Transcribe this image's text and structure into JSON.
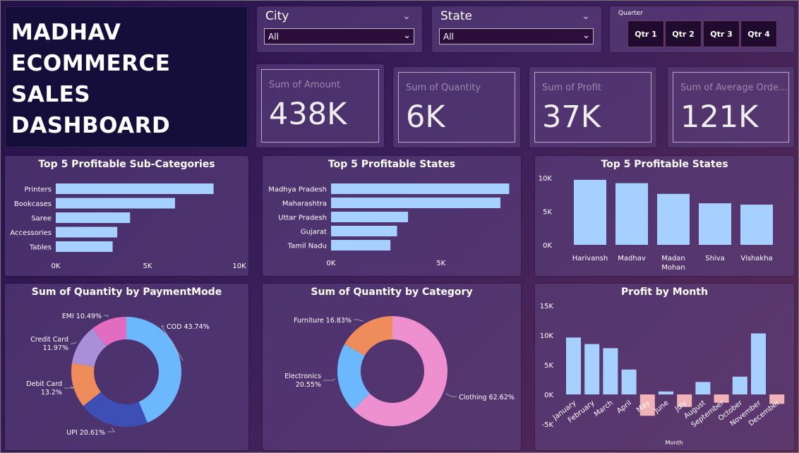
{
  "header": {
    "title_line1": "MADHAV",
    "title_line2": "ECOMMERCE",
    "title_line3": "SALES DASHBOARD"
  },
  "slicers": {
    "city": {
      "label": "City",
      "value": "All"
    },
    "state": {
      "label": "State",
      "value": "All"
    },
    "quarter": {
      "label": "Quarter",
      "options": [
        "Qtr 1",
        "Qtr 2",
        "Qtr 3",
        "Qtr 4"
      ]
    }
  },
  "kpis": [
    {
      "label": "Sum of Amount",
      "value": "438K"
    },
    {
      "label": "Sum of Quantity",
      "value": "6K"
    },
    {
      "label": "Sum of Profit",
      "value": "37K"
    },
    {
      "label": "Sum of Average Orde...",
      "value": "121K"
    }
  ],
  "colors": {
    "bar": "#a6d0ff",
    "negative": "#f2b3b8",
    "cod": "#6cb8ff",
    "upi": "#3d4fb5",
    "debit": "#ee8c5b",
    "credit": "#a98fd8",
    "emi": "#e26cbf",
    "clothing": "#ee8fd0",
    "electronics": "#6cb8ff",
    "furniture": "#ee8c5b"
  },
  "chart_data": [
    {
      "type": "bar",
      "orientation": "horizontal",
      "title": "Top 5 Profitable Sub-Categories",
      "categories": [
        "Printers",
        "Bookcases",
        "Saree",
        "Accessories",
        "Tables"
      ],
      "values": [
        8600,
        6500,
        4050,
        3350,
        3100
      ],
      "ticks": [
        "0K",
        "5K",
        "10K"
      ],
      "xlim": [
        0,
        10000
      ]
    },
    {
      "type": "bar",
      "orientation": "horizontal",
      "title": "Top 5 Profitable States",
      "categories": [
        "Madhya Pradesh",
        "Maharashtra",
        "Uttar Pradesh",
        "Gujarat",
        "Tamil Nadu"
      ],
      "values": [
        8100,
        7700,
        3500,
        3000,
        2700
      ],
      "ticks": [
        "0K",
        "5K"
      ],
      "xlim": [
        0,
        8600
      ]
    },
    {
      "type": "bar",
      "orientation": "vertical",
      "title": "Top 5 Profitable States",
      "categories": [
        "Harivansh",
        "Madhav",
        "Madan Mohan",
        "Shiva",
        "Vishakha"
      ],
      "values": [
        9700,
        9200,
        7600,
        6200,
        6000
      ],
      "ticks": [
        "0K",
        "5K",
        "10K"
      ],
      "ylim": [
        0,
        10000
      ]
    },
    {
      "type": "pie",
      "donut": true,
      "title": "Sum of Quantity by PaymentMode",
      "slices": [
        {
          "label": "COD 43.74%",
          "value": 43.74
        },
        {
          "label": "UPI 20.61%",
          "value": 20.61
        },
        {
          "label": "Debit Card 13.2%",
          "value": 13.2
        },
        {
          "label": "Credit Card 11.97%",
          "value": 11.97
        },
        {
          "label": "EMI 10.49%",
          "value": 10.49
        }
      ]
    },
    {
      "type": "pie",
      "donut": true,
      "title": "Sum of Quantity by Category",
      "slices": [
        {
          "label": "Clothing 62.62%",
          "value": 62.62
        },
        {
          "label": "Electronics 20.55%",
          "value": 20.55
        },
        {
          "label": "Furniture 16.83%",
          "value": 16.83
        }
      ]
    },
    {
      "type": "bar",
      "orientation": "vertical",
      "title": "Profit by Month",
      "xlabel": "Month",
      "categories": [
        "January",
        "February",
        "March",
        "April",
        "May",
        "June",
        "July",
        "August",
        "September",
        "October",
        "November",
        "December"
      ],
      "values": [
        9600,
        8500,
        7800,
        4200,
        -3600,
        500,
        -2100,
        2100,
        -1400,
        3000,
        10300,
        -1600
      ],
      "ticks": [
        "-5K",
        "0K",
        "5K",
        "10K",
        "15K"
      ],
      "ylim": [
        -5000,
        15000
      ]
    }
  ]
}
